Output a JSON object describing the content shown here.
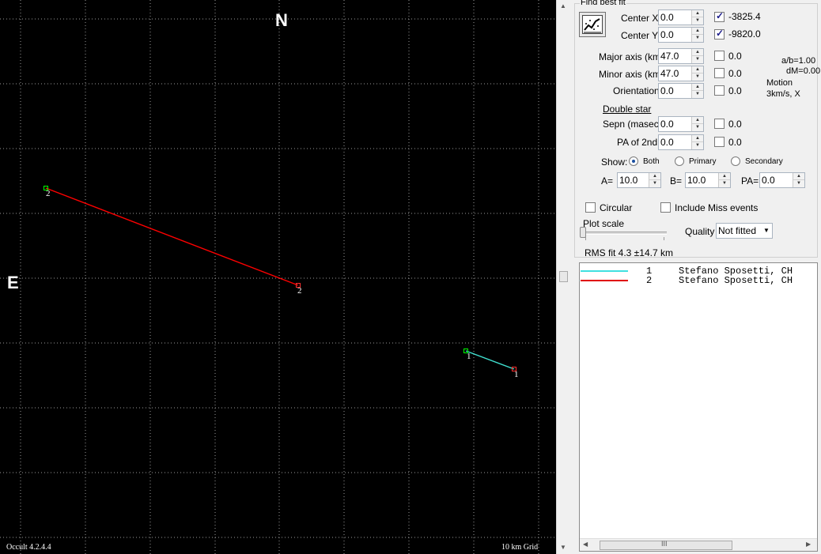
{
  "plot": {
    "north_label": "N",
    "east_label": "E",
    "version_label": "Occult 4.2.4.4",
    "grid_label": "10 km Grid",
    "chords": [
      {
        "id": "1",
        "color": "#40e0d0",
        "start_label": "1",
        "end_label": "1"
      },
      {
        "id": "2",
        "color": "#ff0000",
        "start_label": "2",
        "end_label": "2"
      }
    ],
    "colors": {
      "background": "#000000",
      "grid": "#9a9a9a",
      "start_marker": "#00ff00",
      "end_marker": "#ff3030"
    }
  },
  "panel": {
    "group_title": "Find best fit",
    "fit_icon": "best-fit-chart-icon",
    "center_x": {
      "label": "Center X",
      "value": "0.0",
      "checked": true,
      "result": "-3825.4"
    },
    "center_y": {
      "label": "Center Y",
      "value": "0.0",
      "checked": true,
      "result": "-9820.0"
    },
    "major_axis": {
      "label": "Major axis (km)",
      "value": "47.0",
      "checked": false,
      "result": "0.0"
    },
    "minor_axis": {
      "label": "Minor axis (km)",
      "value": "47.0",
      "checked": false,
      "result": "0.0"
    },
    "orientation": {
      "label": "Orientation",
      "value": "0.0",
      "checked": false,
      "result": "0.0"
    },
    "info": {
      "ab": "a/b=1.00",
      "dm": "dM=0.00",
      "motion": "Motion",
      "motion_value": "3km/s, X"
    },
    "double_star": {
      "title": "Double star",
      "sepn": {
        "label": "Sepn (masec)",
        "value": "0.0",
        "checked": false,
        "result": "0.0"
      },
      "pa2": {
        "label": "PA of 2nd",
        "value": "0.0",
        "checked": false,
        "result": "0.0"
      }
    },
    "show": {
      "label": "Show:",
      "options": [
        "Both",
        "Primary",
        "Secondary"
      ],
      "selected": "Both"
    },
    "a_field": {
      "label": "A=",
      "value": "10.0"
    },
    "b_field": {
      "label": "B=",
      "value": "10.0"
    },
    "pa_field": {
      "label": "PA=",
      "value": "0.0"
    },
    "circular": {
      "label": "Circular",
      "checked": false
    },
    "include_miss": {
      "label": "Include Miss events",
      "checked": false
    },
    "plot_scale": {
      "label": "Plot scale",
      "level": 0.5
    },
    "quality": {
      "label": "Quality",
      "value": "Not fitted"
    },
    "rms": "RMS fit 4.3 ±14.7 km",
    "observers": [
      {
        "num": "1",
        "name": "Stefano Sposetti, CH",
        "color": "#40e0e0"
      },
      {
        "num": "2",
        "name": "Stefano Sposetti, CH",
        "color": "#e00000"
      }
    ],
    "scroll_grip": "III"
  }
}
